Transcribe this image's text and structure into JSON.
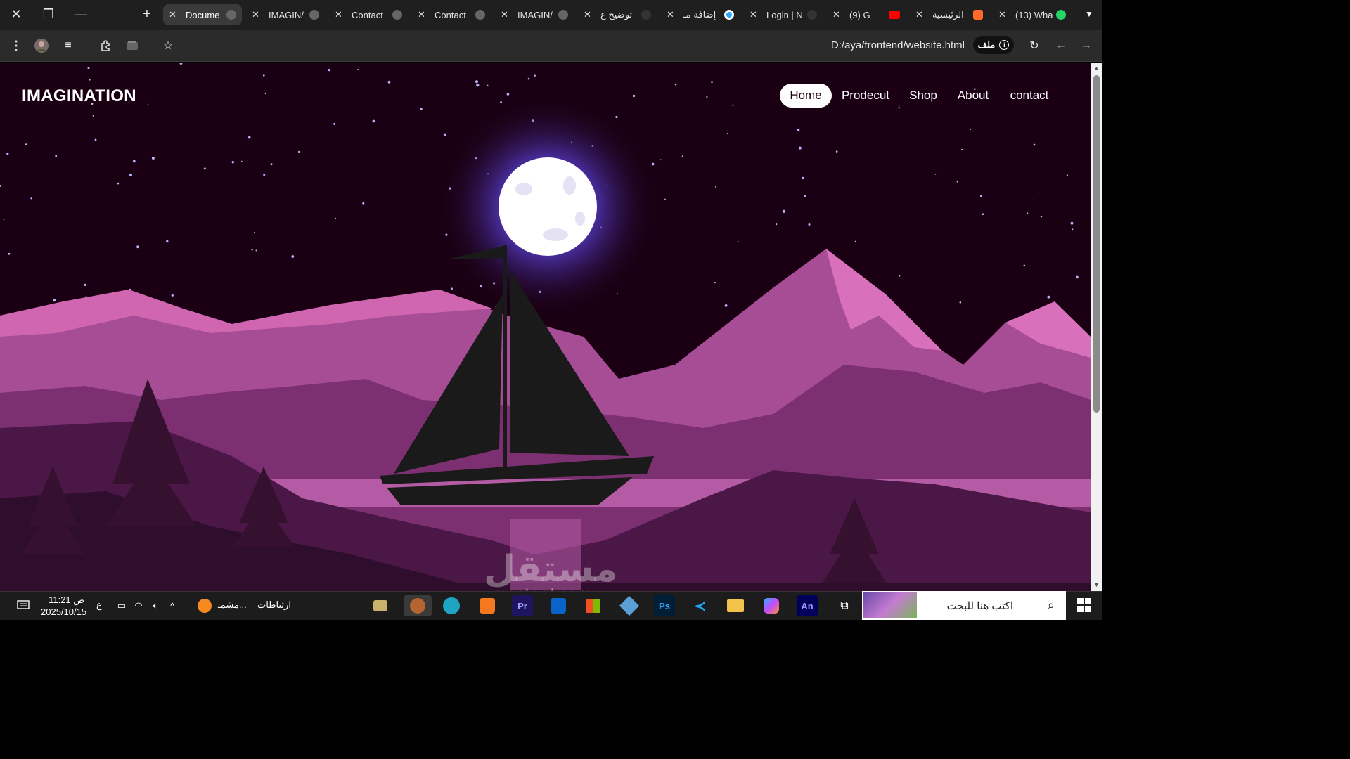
{
  "browser": {
    "tabs": [
      {
        "title": "Docume",
        "active": true
      },
      {
        "title": "IMAGIN/",
        "active": false
      },
      {
        "title": "Contact",
        "active": false
      },
      {
        "title": "Contact",
        "active": false
      },
      {
        "title": "IMAGIN/",
        "active": false
      },
      {
        "title": "توضيح ع",
        "active": false
      },
      {
        "title": "إضافة مـ",
        "active": false
      },
      {
        "title": "Login | N",
        "active": false
      },
      {
        "title": "(9) G",
        "active": false
      },
      {
        "title": "الرئيسية",
        "active": false
      },
      {
        "title": "(13) Wha",
        "active": false
      }
    ],
    "address": {
      "url": "D:/aya/frontend/website.html",
      "site_chip": "ملف"
    }
  },
  "page": {
    "brand": "IMAGINATION",
    "nav": [
      {
        "label": "Home",
        "active": true
      },
      {
        "label": "Prodecut",
        "active": false
      },
      {
        "label": "Shop",
        "active": false
      },
      {
        "label": "About",
        "active": false
      },
      {
        "label": "contact",
        "active": false
      }
    ],
    "colors": {
      "sky": "#1b0014",
      "moon": "#ffffff",
      "moon_glow": "#6d5cff",
      "mountain_light": "#d062b0",
      "mountain_mid": "#a34a91",
      "mountain_dark": "#5c1f56",
      "boat": "#1a1a1a"
    }
  },
  "watermark": {
    "text": "مستقل",
    "url": "mostaql.com"
  },
  "taskbar": {
    "search_placeholder": "اكتب هنا للبحث",
    "time": "11:21 ص",
    "date": "2025/10/15",
    "language": "ع",
    "links_label": "ارتباطات",
    "weather_label": "مشمـ...",
    "apps": [
      "Pr",
      "Ps",
      "An"
    ]
  }
}
